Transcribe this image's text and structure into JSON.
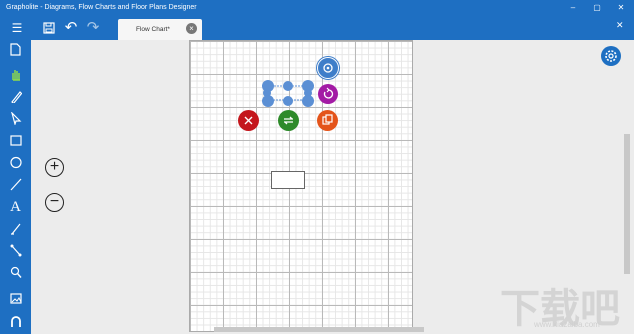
{
  "window": {
    "title": "Grapholite - Diagrams, Flow Charts and Floor Plans Designer",
    "minimize": "–",
    "maximize": "▢",
    "close": "✕"
  },
  "toolbar": {
    "menu_icon": "☰",
    "save_icon": "save-icon",
    "undo_icon": "↶",
    "redo_icon": "↷"
  },
  "tab": {
    "label": "Flow Chart*",
    "close_glyph": "×"
  },
  "zoom": {
    "in": "+",
    "out": "−"
  },
  "watermark": {
    "text": "下载吧",
    "url": "www.xiazaiba.com"
  },
  "colors": {
    "accent": "#1e6fc2",
    "delete": "#c4171d",
    "swap": "#2e8a2a",
    "copy": "#e4541a",
    "rotate": "#a31ba5",
    "settings": "#3f7ec9",
    "handle": "#5b8fd4"
  }
}
